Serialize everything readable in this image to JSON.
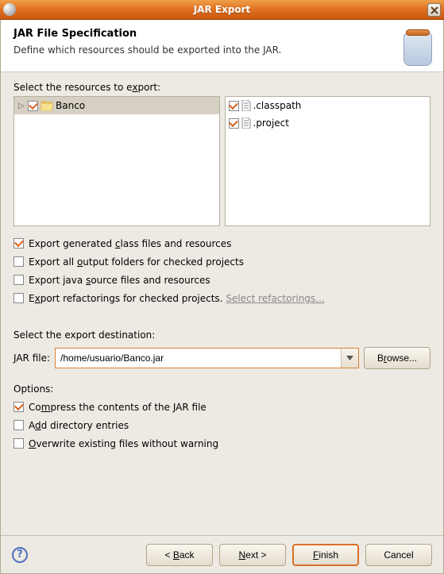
{
  "titlebar": {
    "title": "JAR Export"
  },
  "header": {
    "title": "JAR File Specification",
    "subtitle": "Define which resources should be exported into the JAR."
  },
  "resources": {
    "label_pre": "Select the resources to e",
    "label_u": "x",
    "label_post": "port:",
    "left": [
      {
        "label": "Banco",
        "checked": true,
        "expandable": true,
        "selected": true
      }
    ],
    "right": [
      {
        "label": ".classpath",
        "checked": true
      },
      {
        "label": ".project",
        "checked": true
      }
    ]
  },
  "export_opts": {
    "generated": {
      "label_pre": "Export generated ",
      "label_u": "c",
      "label_post": "lass files and resources",
      "checked": true
    },
    "output": {
      "label_pre": "Export all ",
      "label_u": "o",
      "label_post": "utput folders for checked projects",
      "checked": false
    },
    "source": {
      "label_pre": "Export java ",
      "label_u": "s",
      "label_post": "ource files and resources",
      "checked": false
    },
    "refactor": {
      "label_pre": "E",
      "label_u": "x",
      "label_post": "port refactorings for checked projects.",
      "link": "Select refactorings...",
      "checked": false
    }
  },
  "dest": {
    "section_label": "Select the export destination:",
    "field_label_u": "J",
    "field_label_post": "AR file:",
    "value": "/home/usuario/Banco.jar",
    "browse_u": "r",
    "browse_pre": "B",
    "browse_post": "owse..."
  },
  "options": {
    "section_label": "Options:",
    "compress": {
      "label_pre": "Co",
      "label_u": "m",
      "label_post": "press the contents of the JAR file",
      "checked": true
    },
    "dirs": {
      "label_pre": "A",
      "label_u": "d",
      "label_post": "d directory entries",
      "checked": false
    },
    "overwrite": {
      "label_pre": "",
      "label_u": "O",
      "label_post": "verwrite existing files without warning",
      "checked": false
    }
  },
  "footer": {
    "back_pre": "< ",
    "back_u": "B",
    "back_post": "ack",
    "next_pre": "",
    "next_u": "N",
    "next_post": "ext >",
    "finish_pre": "",
    "finish_u": "F",
    "finish_post": "inish",
    "cancel": "Cancel"
  }
}
